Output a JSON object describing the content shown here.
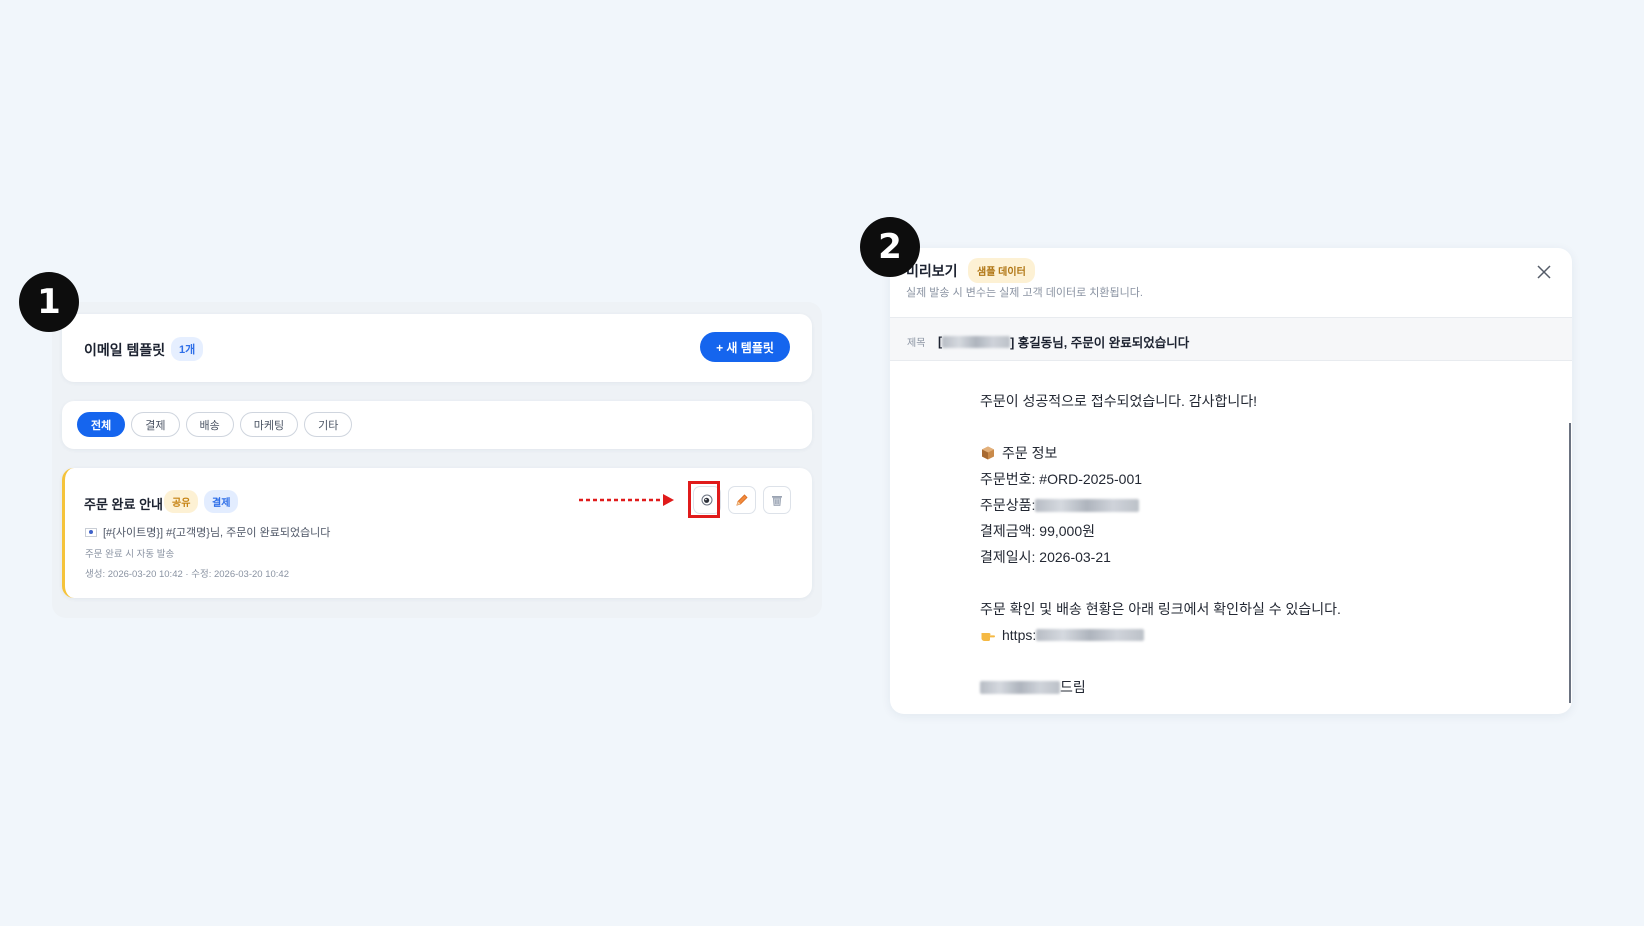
{
  "steps": {
    "one": "1",
    "two": "2"
  },
  "template_list": {
    "title": "이메일 템플릿",
    "count": "1개",
    "new_button": "+ 새 템플릿",
    "filters": [
      "전체",
      "결제",
      "배송",
      "마케팅",
      "기타"
    ],
    "active_filter": "전체",
    "template": {
      "name": "주문 완료 안내",
      "tags": [
        "공유",
        "결제"
      ],
      "subject": "[#{사이트명}] #{고객명}님, 주문이 완료되었습니다",
      "description": "주문 완료 시 자동 발송",
      "dates": "생성: 2026-03-20 10:42 · 수정: 2026-03-20 10:42",
      "actions": [
        "view",
        "edit",
        "delete"
      ]
    }
  },
  "preview": {
    "title": "미리보기",
    "badge": "샘플 데이터",
    "note": "실제 발송 시 변수는 실제 고객 데이터로 치환됩니다.",
    "subject_label": "제목",
    "subject_suffix": "] 홍길동님, 주문이 완료되었습니다",
    "subject_prefix": "[",
    "body": {
      "greeting": "주문이 성공적으로 접수되었습니다. 감사합니다!",
      "section_title": "주문 정보",
      "order_no": "주문번호: #ORD-2025-001",
      "product_label": "주문상품: ",
      "amount": "결제금액: 99,000원",
      "date": "결제일시: 2026-03-21",
      "guide": "주문 확인 및 배송 현황은 아래 링크에서 확인하실 수 있습니다.",
      "link_prefix": "https:",
      "closing_suffix": " 드림"
    }
  },
  "colors": {
    "accent": "#1565ee",
    "highlight": "#e01b1b",
    "background": "#f1f6fb"
  }
}
